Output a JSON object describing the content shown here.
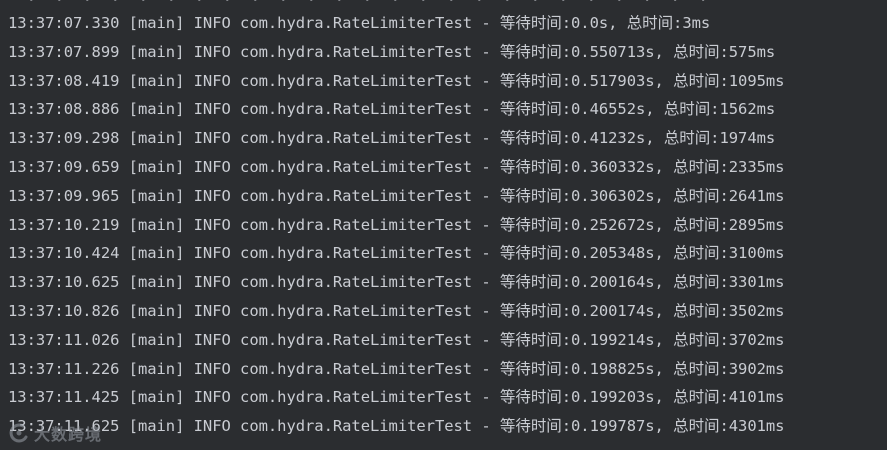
{
  "console": {
    "cut_top_line": "  ·  ·  ·  ·  ·  ·  ·  ·  ·  ·  ·  ·  ·  ·  ·  ·  ·  ·  ·  ·  ·  ·  ·  ·  ·",
    "lines": [
      "13:37:07.330 [main] INFO com.hydra.RateLimiterTest - 等待时间:0.0s, 总时间:3ms",
      "13:37:07.899 [main] INFO com.hydra.RateLimiterTest - 等待时间:0.550713s, 总时间:575ms",
      "13:37:08.419 [main] INFO com.hydra.RateLimiterTest - 等待时间:0.517903s, 总时间:1095ms",
      "13:37:08.886 [main] INFO com.hydra.RateLimiterTest - 等待时间:0.46552s, 总时间:1562ms",
      "13:37:09.298 [main] INFO com.hydra.RateLimiterTest - 等待时间:0.41232s, 总时间:1974ms",
      "13:37:09.659 [main] INFO com.hydra.RateLimiterTest - 等待时间:0.360332s, 总时间:2335ms",
      "13:37:09.965 [main] INFO com.hydra.RateLimiterTest - 等待时间:0.306302s, 总时间:2641ms",
      "13:37:10.219 [main] INFO com.hydra.RateLimiterTest - 等待时间:0.252672s, 总时间:2895ms",
      "13:37:10.424 [main] INFO com.hydra.RateLimiterTest - 等待时间:0.205348s, 总时间:3100ms",
      "13:37:10.625 [main] INFO com.hydra.RateLimiterTest - 等待时间:0.200164s, 总时间:3301ms",
      "13:37:10.826 [main] INFO com.hydra.RateLimiterTest - 等待时间:0.200174s, 总时间:3502ms",
      "13:37:11.026 [main] INFO com.hydra.RateLimiterTest - 等待时间:0.199214s, 总时间:3702ms",
      "13:37:11.226 [main] INFO com.hydra.RateLimiterTest - 等待时间:0.198825s, 总时间:3902ms",
      "13:37:11.425 [main] INFO com.hydra.RateLimiterTest - 等待时间:0.199203s, 总时间:4101ms",
      "13:37:11.625 [main] INFO com.hydra.RateLimiterTest - 等待时间:0.199787s, 总时间:4301ms"
    ]
  },
  "watermark": {
    "icon": "brand-logo-icon",
    "text": "大数跨境"
  },
  "colors": {
    "background": "#2b2d30",
    "text": "#c9ccd2"
  }
}
